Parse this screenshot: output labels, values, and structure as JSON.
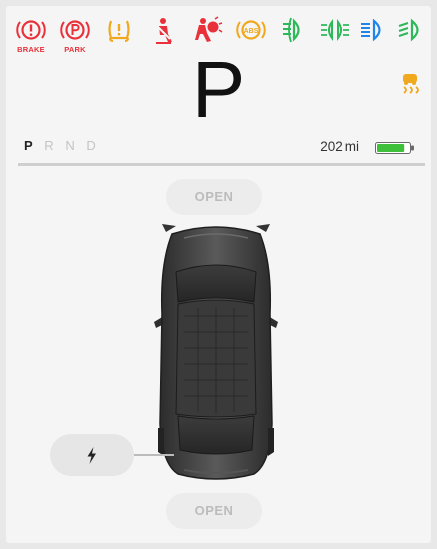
{
  "telltales": [
    {
      "name": "brake-warning",
      "label": "BRAKE",
      "color": "#e8313a"
    },
    {
      "name": "parking-brake",
      "label": "PARK",
      "color": "#e8313a"
    },
    {
      "name": "tire-pressure-warning",
      "label": "",
      "color": "#f0a81e"
    },
    {
      "name": "seatbelt-warning",
      "label": "",
      "color": "#e8313a"
    },
    {
      "name": "airbag-warning",
      "label": "",
      "color": "#e8313a"
    },
    {
      "name": "abs-warning",
      "label": "ABS",
      "color": "#f0a81e"
    },
    {
      "name": "fog-lights",
      "label": "",
      "color": "#2db85a"
    },
    {
      "name": "parking-lights",
      "label": "",
      "color": "#2db85a"
    },
    {
      "name": "high-beam",
      "label": "",
      "color": "#1e86e8"
    },
    {
      "name": "low-beam",
      "label": "",
      "color": "#2db85a"
    }
  ],
  "gear": {
    "current": "P",
    "options": [
      "P",
      "R",
      "N",
      "D"
    ]
  },
  "traction_icon": "traction-control-off-icon",
  "range": {
    "value": "202",
    "unit": "mi"
  },
  "battery": {
    "level": 0.85,
    "color": "#3fc03a"
  },
  "doors": {
    "front_label": "OPEN",
    "rear_label": "OPEN"
  },
  "charge_icon": "lightning-bolt-icon"
}
